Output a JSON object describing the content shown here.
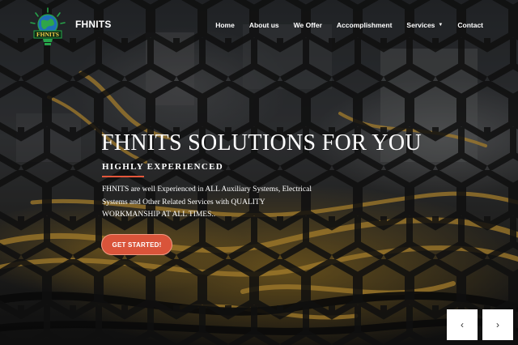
{
  "brand": {
    "name": "FHNITS",
    "logo_text": "FHNITS"
  },
  "nav": {
    "items": [
      {
        "label": "Home"
      },
      {
        "label": "About us"
      },
      {
        "label": "We Offer"
      },
      {
        "label": "Accomplishment"
      },
      {
        "label": "Services",
        "has_dropdown": true
      },
      {
        "label": "Contact"
      }
    ]
  },
  "hero": {
    "title": "FHNITS SOLUTIONS FOR YOU",
    "subtitle": "HIGHLY EXPERIENCED",
    "description": "FHNITS are well Experienced in ALL Auxiliary Systems, Electrical Systems and Other Related Services with QUALITY WORKMANSHIP AT ALL TIMES..",
    "cta_label": "GET STARTED!"
  },
  "carousel": {
    "prev_glyph": "‹",
    "next_glyph": "›"
  },
  "colors": {
    "accent": "#d9543a",
    "nav_text": "#ffffff",
    "logo_green": "#27a34a"
  },
  "icons": {
    "logo": "lightbulb-globe-logo",
    "dropdown": "caret-down-icon",
    "prev": "chevron-left-icon",
    "next": "chevron-right-icon"
  }
}
